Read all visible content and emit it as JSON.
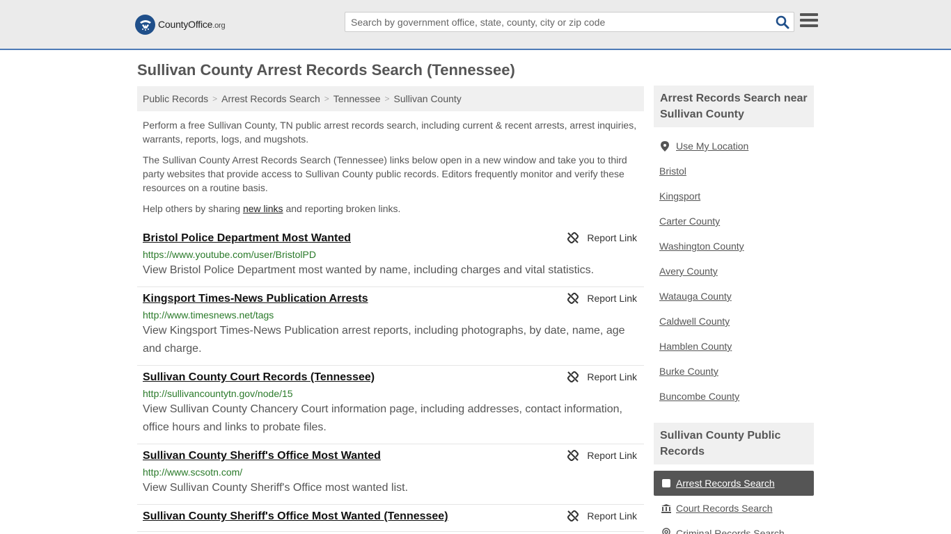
{
  "header": {
    "logo_text": "CountyOffice",
    "logo_suffix": ".org",
    "search_placeholder": "Search by government office, state, county, city or zip code"
  },
  "page_title": "Sullivan County Arrest Records Search (Tennessee)",
  "breadcrumb": [
    "Public Records",
    "Arrest Records Search",
    "Tennessee",
    "Sullivan County"
  ],
  "intro": {
    "p1": "Perform a free Sullivan County, TN public arrest records search, including current & recent arrests, arrest inquiries, warrants, reports, logs, and mugshots.",
    "p2": "The Sullivan County Arrest Records Search (Tennessee) links below open in a new window and take you to third party websites that provide access to Sullivan County public records. Editors frequently monitor and verify these resources on a routine basis.",
    "p3_before": "Help others by sharing ",
    "p3_link": "new links",
    "p3_after": " and reporting broken links."
  },
  "report_label": "Report Link",
  "listings": [
    {
      "title": "Bristol Police Department Most Wanted",
      "url": "https://www.youtube.com/user/BristolPD",
      "desc": "View Bristol Police Department most wanted by name, including charges and vital statistics."
    },
    {
      "title": "Kingsport Times-News Publication Arrests",
      "url": "http://www.timesnews.net/tags",
      "desc": "View Kingsport Times-News Publication arrest reports, including photographs, by date, name, age and charge."
    },
    {
      "title": "Sullivan County Court Records (Tennessee)",
      "url": "http://sullivancountytn.gov/node/15",
      "desc": "View Sullivan County Chancery Court information page, including addresses, contact information, office hours and links to probate files."
    },
    {
      "title": "Sullivan County Sheriff's Office Most Wanted",
      "url": "http://www.scsotn.com/",
      "desc": "View Sullivan County Sheriff's Office most wanted list."
    },
    {
      "title": "Sullivan County Sheriff's Office Most Wanted (Tennessee)",
      "url": "",
      "desc": ""
    }
  ],
  "sidebar": {
    "nearby_heading": "Arrest Records Search near Sullivan County",
    "use_location": "Use My Location",
    "nearby": [
      "Bristol",
      "Kingsport",
      "Carter County",
      "Washington County",
      "Avery County",
      "Watauga County",
      "Caldwell County",
      "Hamblen County",
      "Burke County",
      "Buncombe County"
    ],
    "records_heading": "Sullivan County Public Records",
    "records": [
      "Arrest Records Search",
      "Court Records Search",
      "Criminal Records Search"
    ]
  },
  "colors": {
    "accent": "#4d7ab6",
    "link_green": "#2a7a2a",
    "active_bg": "#555555"
  }
}
